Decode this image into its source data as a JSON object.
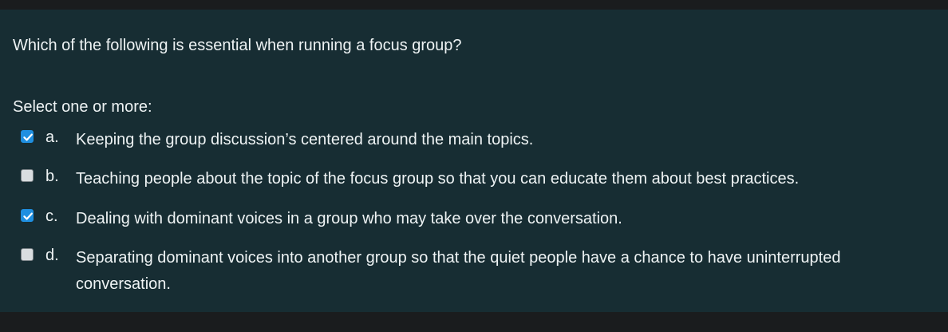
{
  "question": {
    "text": "Which of the following is essential when running a focus group?",
    "prompt": "Select one or more:"
  },
  "options": [
    {
      "letter": "a.",
      "text": "Keeping the group discussion’s centered around the main topics.",
      "checked": true
    },
    {
      "letter": "b.",
      "text": "Teaching people about the topic of the focus group so that you can educate them about best practices.",
      "checked": false
    },
    {
      "letter": "c.",
      "text": "Dealing with dominant voices in a group who may take over the conversation.",
      "checked": true
    },
    {
      "letter": "d.",
      "text": "Separating dominant voices into another group so that the quiet people have a chance to have uninterrupted conversation.",
      "checked": false
    }
  ],
  "colors": {
    "panel_background": "#172d33",
    "page_background": "#1a1c1e",
    "text": "#eef3f4",
    "checkbox_checked": "#1f8fe0",
    "checkbox_unchecked": "#d9dde0"
  },
  "icons": {
    "checked_box": "checkbox-checked-icon",
    "unchecked_box": "checkbox-unchecked-icon"
  }
}
